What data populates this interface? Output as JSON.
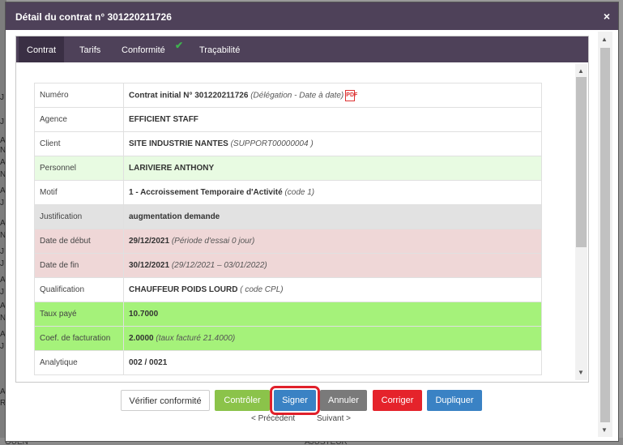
{
  "background": {
    "left_letters": [
      "J",
      "J",
      "A",
      "N",
      "A",
      "N",
      "A",
      "J",
      "A",
      "N",
      "J",
      "J",
      "A",
      "J",
      "A",
      "N",
      "A",
      "J",
      "A",
      "R"
    ],
    "bottom_texts": [
      "OUEN",
      "AJUSTEUR"
    ]
  },
  "dialog": {
    "title": "Détail du contrat n° 301220211726",
    "close_glyph": "×"
  },
  "tabs": [
    {
      "label": "Contrat",
      "active": true
    },
    {
      "label": "Tarifs"
    },
    {
      "label": "Conformité",
      "badge": "✔"
    },
    {
      "label": "Traçabilité"
    }
  ],
  "details": {
    "numero": {
      "label": "Numéro",
      "value": "Contrat initial N° 301220211726",
      "note": "(Délégation - Date à date)",
      "icon": "pdf-icon"
    },
    "agence": {
      "label": "Agence",
      "value": "EFFICIENT STAFF"
    },
    "client": {
      "label": "Client",
      "value": "SITE INDUSTRIE NANTES",
      "note": "(SUPPORT00000004 )"
    },
    "personnel": {
      "label": "Personnel",
      "value": "LARIVIERE ANTHONY"
    },
    "motif": {
      "label": "Motif",
      "value": "1 - Accroissement Temporaire d'Activité",
      "note": "(code 1)"
    },
    "justification": {
      "label": "Justification",
      "value": "augmentation demande"
    },
    "date_debut": {
      "label": "Date de début",
      "value": "29/12/2021",
      "note": "(Période d'essai 0 jour)"
    },
    "date_fin": {
      "label": "Date de fin",
      "value": "30/12/2021",
      "note": "(29/12/2021 – 03/01/2022)"
    },
    "qualification": {
      "label": "Qualification",
      "value": "CHAUFFEUR POIDS LOURD",
      "note": "( code CPL)"
    },
    "taux_paye": {
      "label": "Taux payé",
      "value": "10.7000"
    },
    "coef": {
      "label": "Coef. de facturation",
      "value": "2.0000",
      "note": "(taux facturé 21.4000)"
    },
    "analytique": {
      "label": "Analytique",
      "value": "002 / 0021"
    }
  },
  "buttons": {
    "verify": "Vérifier conformité",
    "control": "Contrôler",
    "sign": "Signer",
    "cancel": "Annuler",
    "fix": "Corriger",
    "duplicate": "Dupliquer"
  },
  "nav": {
    "prev": "< Précédent",
    "next": "Suivant >"
  },
  "colors": {
    "header": "#4e4159",
    "green_row": "#e8fbe2",
    "pink_row": "#efd7d7",
    "lime_row": "#a5f27a",
    "grey_row": "#e2e2e2",
    "sign_highlight": "#e0202a"
  }
}
